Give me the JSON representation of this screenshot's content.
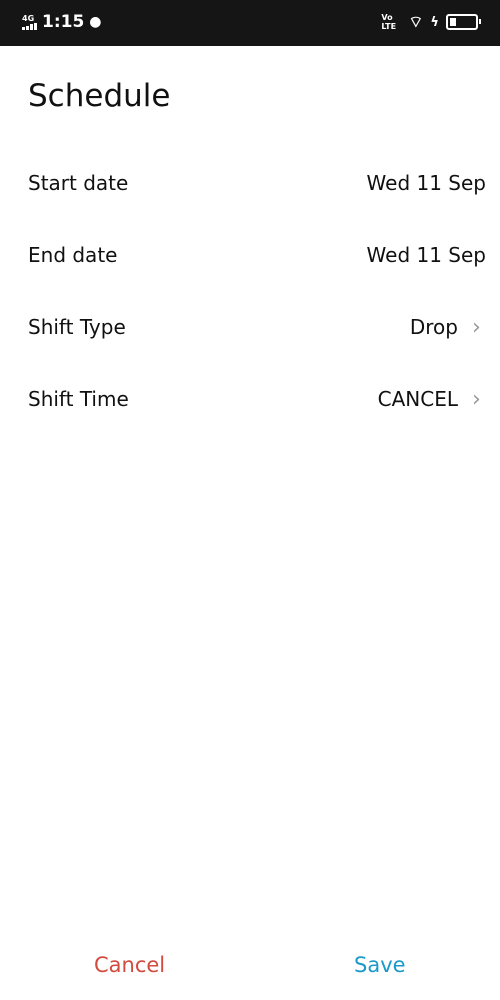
{
  "status_bar": {
    "network": "4G",
    "time": "1:15",
    "volte": "Vo LTE"
  },
  "title": "Schedule",
  "rows": [
    {
      "label": "Start date",
      "value": "Wed 11 Sep",
      "chevron": false
    },
    {
      "label": "End date",
      "value": "Wed 11 Sep",
      "chevron": false
    },
    {
      "label": "Shift Type",
      "value": "Drop",
      "chevron": true
    },
    {
      "label": "Shift Time",
      "value": "CANCEL",
      "chevron": true
    }
  ],
  "footer": {
    "cancel_label": "Cancel",
    "save_label": "Save"
  },
  "colors": {
    "cancel": "#d24b3e",
    "save": "#1a9ac9",
    "status_bar": "#151515"
  }
}
